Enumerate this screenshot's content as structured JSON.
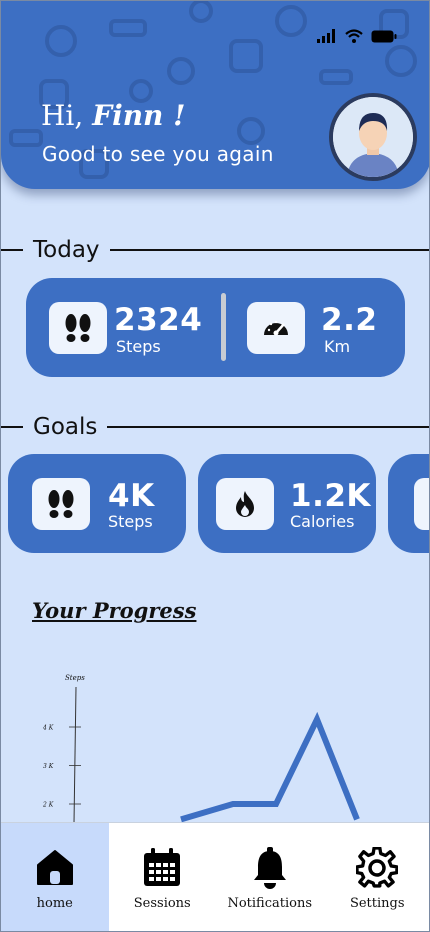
{
  "header": {
    "greeting_prefix": "Hi,",
    "user_name": "Finn !",
    "subtitle": "Good to see you again",
    "bg_color": "#3d6fc3"
  },
  "today": {
    "title": "Today",
    "steps_value": "2324",
    "steps_label": "Steps",
    "distance_value": "2.2",
    "distance_label": "Km"
  },
  "goals": {
    "title": "Goals",
    "items": [
      {
        "value": "4K",
        "label": "Steps",
        "icon": "footprints-icon"
      },
      {
        "value": "1.2K",
        "label": "Calories",
        "icon": "flame-icon"
      }
    ]
  },
  "progress": {
    "title": "Your Progress",
    "chart_data": {
      "type": "line",
      "ylabel": "Steps",
      "yticks": [
        "4 K",
        "3 K",
        "2 K"
      ],
      "ytick_values": [
        4000,
        3000,
        2000
      ],
      "series": [
        {
          "values": [
            1600,
            2000,
            2000,
            4200,
            1600
          ]
        }
      ]
    }
  },
  "nav": {
    "items": [
      {
        "label": "home",
        "icon": "home-icon",
        "active": true
      },
      {
        "label": "Sessions",
        "icon": "calendar-icon",
        "active": false
      },
      {
        "label": "Notifications",
        "icon": "bell-icon",
        "active": false
      },
      {
        "label": "Settings",
        "icon": "gear-icon",
        "active": false
      }
    ]
  }
}
